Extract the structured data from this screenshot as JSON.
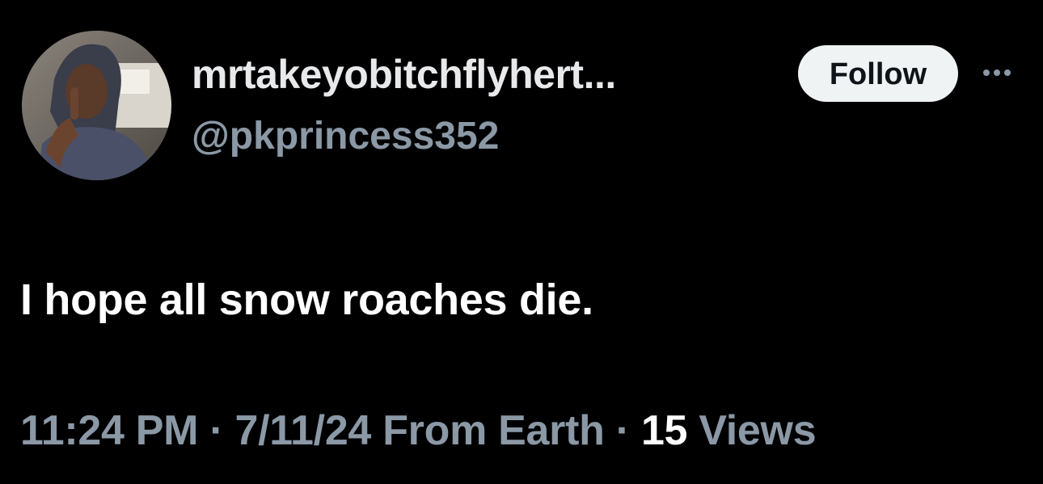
{
  "user": {
    "display_name": "mrtakeyobitchflyhert...",
    "handle": "@pkprincess352",
    "avatar_icon": "profile-photo"
  },
  "actions": {
    "follow_label": "Follow",
    "more_icon": "more-horizontal-icon"
  },
  "tweet": {
    "text": "I hope all snow roaches die."
  },
  "meta": {
    "time": "11:24 PM",
    "separator": "·",
    "date": "7/11/24",
    "source": "From Earth",
    "views_count": "15",
    "views_label": "Views"
  },
  "colors": {
    "background": "#000000",
    "primary_text": "#e7e9ea",
    "secondary_text": "#8b98a5",
    "follow_button_bg": "#eff3f4",
    "follow_button_text": "#0f1419"
  }
}
